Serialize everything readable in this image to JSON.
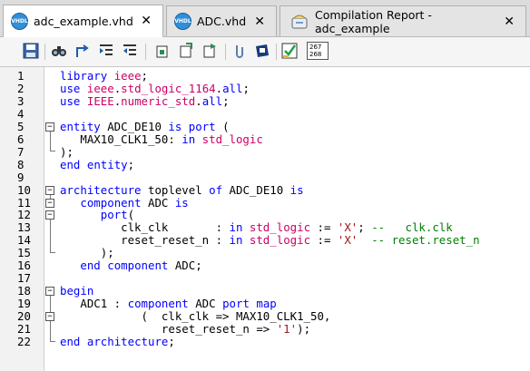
{
  "tabs": [
    {
      "label": "adc_example.vhd",
      "icon": "vhdl-file-icon",
      "active": true
    },
    {
      "label": "ADC.vhd",
      "icon": "vhdl-file-icon",
      "active": false
    },
    {
      "label": "Compilation Report - adc_example",
      "icon": "report-icon",
      "active": false
    }
  ],
  "tab_icon_text": "VHDL",
  "close_glyph": "✕",
  "toolbar": {
    "line_counter_top": "267",
    "line_counter_bottom": "268",
    "icons": [
      "save-icon",
      "find-icon",
      "find-replace-icon",
      "indent-icon",
      "outdent-icon",
      "fold-icon",
      "unfold-icon",
      "toggle-bookmark-icon",
      "comment-icon",
      "template-icon",
      "check-icon",
      "line-numbers-icon"
    ]
  },
  "colors": {
    "keyword": "#0000ff",
    "string": "#a31515",
    "type": "#cc0066",
    "comment": "#008000"
  },
  "code_lines": [
    {
      "n": "1",
      "text": "library ieee;"
    },
    {
      "n": "2",
      "text": "use ieee.std_logic_1164.all;"
    },
    {
      "n": "3",
      "text": "use IEEE.numeric_std.all;"
    },
    {
      "n": "4",
      "text": ""
    },
    {
      "n": "5",
      "text": "entity ADC_DE10 is port ("
    },
    {
      "n": "6",
      "text": "   MAX10_CLK1_50: in std_logic"
    },
    {
      "n": "7",
      "text": ");"
    },
    {
      "n": "8",
      "text": "end entity;"
    },
    {
      "n": "9",
      "text": ""
    },
    {
      "n": "10",
      "text": "architecture toplevel of ADC_DE10 is"
    },
    {
      "n": "11",
      "text": "   component ADC is"
    },
    {
      "n": "12",
      "text": "      port("
    },
    {
      "n": "13",
      "text": "         clk_clk       : in std_logic := 'X'; --   clk.clk"
    },
    {
      "n": "14",
      "text": "         reset_reset_n : in std_logic := 'X'  -- reset.reset_n"
    },
    {
      "n": "15",
      "text": "      );"
    },
    {
      "n": "16",
      "text": "   end component ADC;"
    },
    {
      "n": "17",
      "text": ""
    },
    {
      "n": "18",
      "text": "begin"
    },
    {
      "n": "19",
      "text": "   ADC1 : component ADC port map"
    },
    {
      "n": "20",
      "text": "            (  clk_clk => MAX10_CLK1_50,"
    },
    {
      "n": "21",
      "text": "               reset_reset_n => '1');"
    },
    {
      "n": "22",
      "text": "end architecture;"
    }
  ]
}
